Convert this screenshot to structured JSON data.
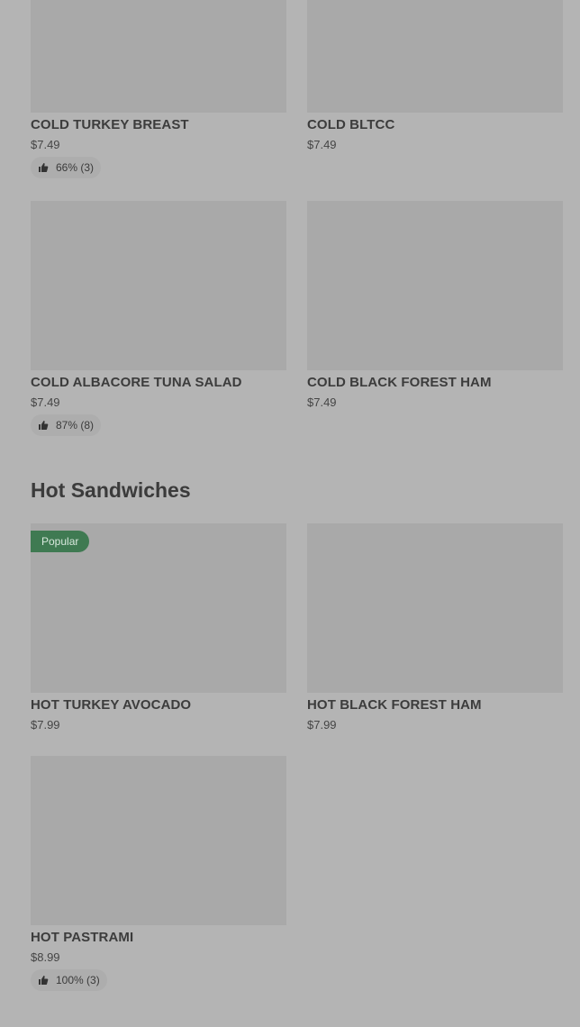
{
  "sections": {
    "hot_title": "Hot Sandwiches"
  },
  "items": [
    {
      "name": "COLD TURKEY BREAST",
      "price": "$7.49",
      "rating": "66% (3)"
    },
    {
      "name": "COLD BLTCC",
      "price": "$7.49"
    },
    {
      "name": "COLD ALBACORE TUNA SALAD",
      "price": "$7.49",
      "rating": "87% (8)"
    },
    {
      "name": "COLD BLACK FOREST HAM",
      "price": "$7.49"
    },
    {
      "name": "HOT TURKEY AVOCADO",
      "price": "$7.99",
      "badge": "Popular"
    },
    {
      "name": "HOT BLACK FOREST HAM",
      "price": "$7.99"
    },
    {
      "name": "HOT PASTRAMI",
      "price": "$8.99",
      "rating": "100% (3)"
    }
  ],
  "colors": {
    "background": "#b4b4b4",
    "image_placeholder": "#a9a9a9",
    "popular_badge": "#3f7a52"
  },
  "icons": {
    "rating": "thumbs-up-icon"
  }
}
